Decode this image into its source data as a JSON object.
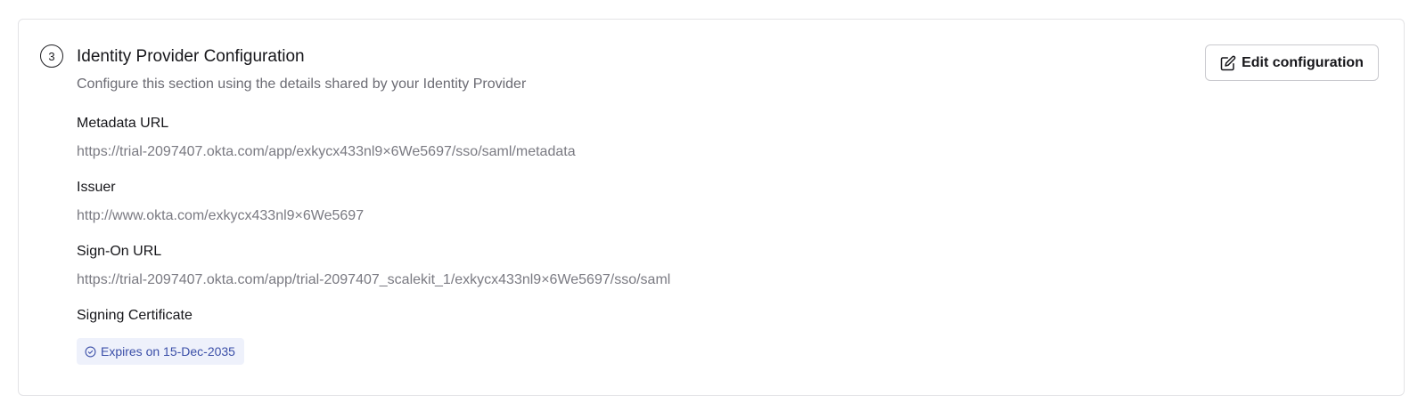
{
  "section": {
    "step_number": "3",
    "title": "Identity Provider Configuration",
    "subtitle": "Configure this section using the details shared by your Identity Provider",
    "edit_button_label": "Edit configuration"
  },
  "fields": {
    "metadata_url": {
      "label": "Metadata URL",
      "value": "https://trial-2097407.okta.com/app/exkycx433nl9×6We5697/sso/saml/metadata"
    },
    "issuer": {
      "label": "Issuer",
      "value": "http://www.okta.com/exkycx433nl9×6We5697"
    },
    "sign_on_url": {
      "label": "Sign-On URL",
      "value": "https://trial-2097407.okta.com/app/trial-2097407_scalekit_1/exkycx433nl9×6We5697/sso/saml"
    },
    "signing_certificate": {
      "label": "Signing Certificate",
      "badge_text": "Expires on 15-Dec-2035",
      "badge_icon": "check-circle-icon"
    }
  },
  "colors": {
    "badge_bg": "#eef1fb",
    "badge_text": "#3b4fa8",
    "border": "#e3e3e6"
  }
}
